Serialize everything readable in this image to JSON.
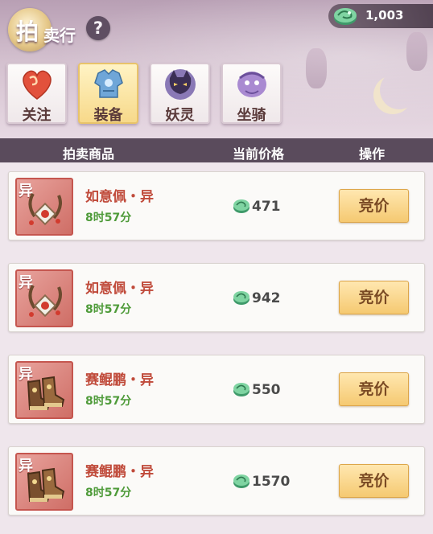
{
  "header": {
    "title_main": "拍",
    "title_sub": "卖行",
    "help_label": "?",
    "currency_value": "1,003",
    "currency_icon": "jade-coin-icon"
  },
  "tabs": [
    {
      "label": "关注",
      "icon": "heart-icon",
      "active": false
    },
    {
      "label": "装备",
      "icon": "armor-icon",
      "active": true
    },
    {
      "label": "妖灵",
      "icon": "spirit-icon",
      "active": false
    },
    {
      "label": "坐骑",
      "icon": "mount-icon",
      "active": false
    }
  ],
  "columns": {
    "item": "拍卖商品",
    "price": "当前价格",
    "action": "操作"
  },
  "rows": [
    {
      "tag": "异",
      "name": "如意佩・异",
      "time": "8时57分",
      "price": "471",
      "button": "竞价",
      "icon": "pendant-icon"
    },
    {
      "tag": "异",
      "name": "如意佩・异",
      "time": "8时57分",
      "price": "942",
      "button": "竞价",
      "icon": "pendant-icon"
    },
    {
      "tag": "异",
      "name": "赛鲲鹏・异",
      "time": "8时57分",
      "price": "550",
      "button": "竞价",
      "icon": "boots-icon"
    },
    {
      "tag": "异",
      "name": "赛鲲鹏・异",
      "time": "8时57分",
      "price": "1570",
      "button": "竞价",
      "icon": "boots-icon"
    }
  ],
  "colors": {
    "header_bar": "#5a4b5c",
    "item_name": "#c04a3a",
    "time_text": "#4f9b3a",
    "bid_button": "#f5c971"
  }
}
